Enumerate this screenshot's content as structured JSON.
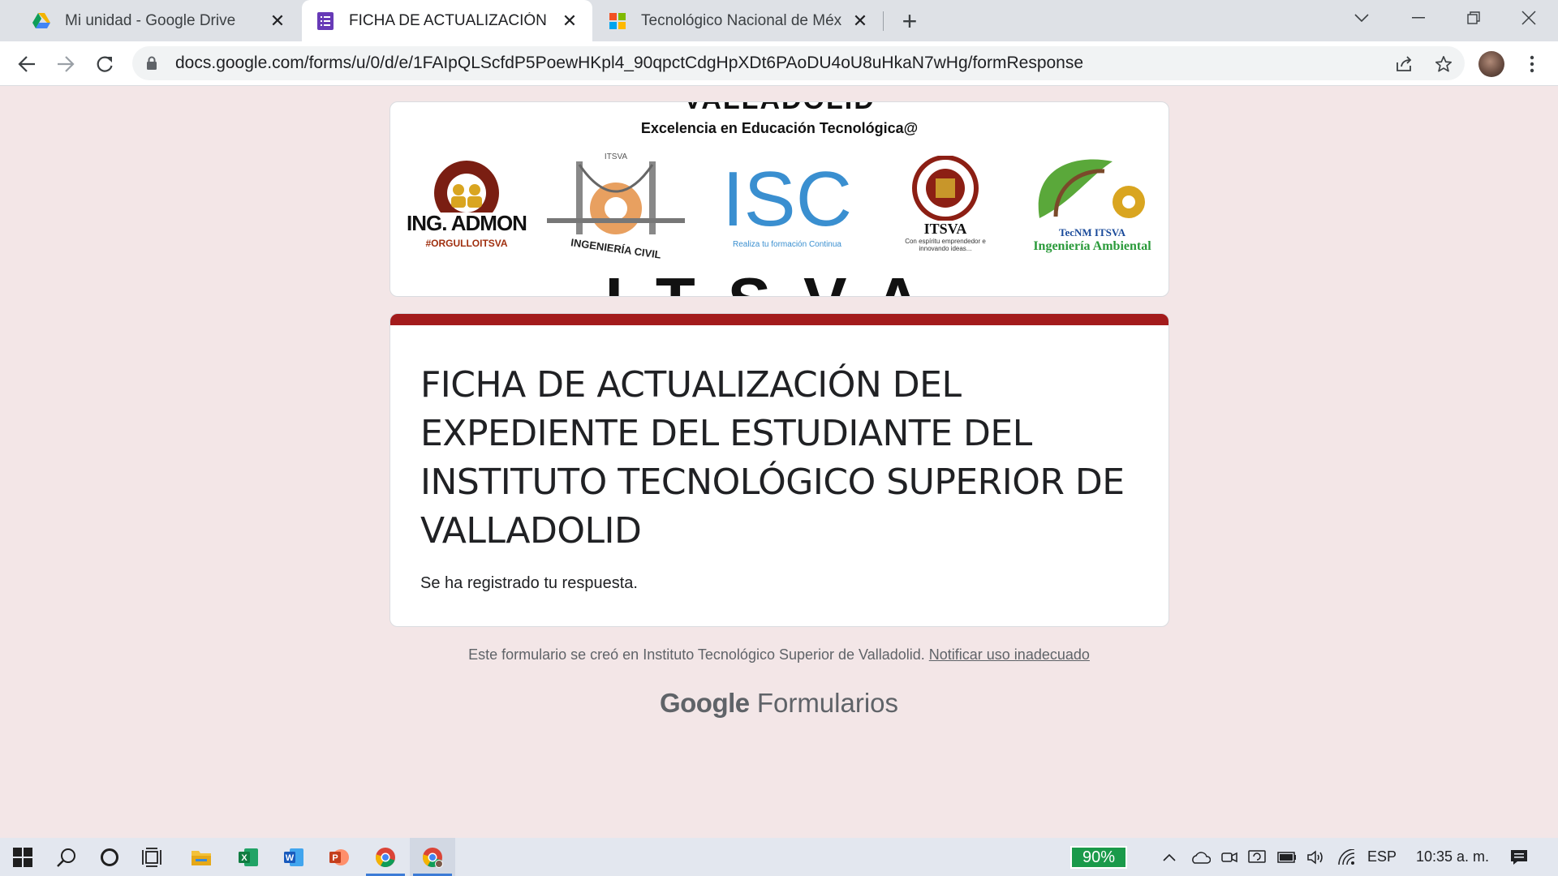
{
  "browser": {
    "tabs": [
      {
        "title": "Mi unidad - Google Drive",
        "icon": "google-drive-icon",
        "active": false
      },
      {
        "title": "FICHA DE ACTUALIZACIÓN DEL E",
        "icon": "google-forms-icon",
        "active": true
      },
      {
        "title": "Tecnológico Nacional de México",
        "icon": "microsoft-icon",
        "active": false
      }
    ],
    "close_glyph": "✕",
    "new_tab_glyph": "+",
    "url": "docs.google.com/forms/u/0/d/e/1FAIpQLScfdP5PoewHKpl4_90qpctCdgHpXDt6PAoDU4oU8uHkaN7wHg/formResponse"
  },
  "header_image": {
    "top_text": "VALLADOLID",
    "subtitle": "Excelencia en Educación Tecnológica@",
    "logos": [
      {
        "name": "ING. ADMON",
        "caption": "#ORGULLOITSVA"
      },
      {
        "name": "ITSVA",
        "caption": "INGENIERÍA CIVIL"
      },
      {
        "name": "ISC",
        "caption": "Realiza tu formación Continua"
      },
      {
        "name": "ITSVA",
        "caption": "Con espíritu emprendedor e innovando ideas..."
      },
      {
        "name": "TecNM ITSVA",
        "caption": "Ingeniería Ambiental"
      }
    ],
    "bottom_text": "ITSVA"
  },
  "form": {
    "title": "FICHA DE ACTUALIZACIÓN DEL EXPEDIENTE DEL ESTUDIANTE DEL INSTITUTO TECNOLÓGICO SUPERIOR DE VALLADOLID",
    "confirmation": "Se ha registrado tu respuesta.",
    "accent_color": "#a31b1c"
  },
  "footer": {
    "created_text": "Este formulario se creó en Instituto Tecnológico Superior de Valladolid.",
    "report_link": "Notificar uso inadecuado",
    "brand_google": "Google",
    "brand_product": "Formularios"
  },
  "taskbar": {
    "battery_percent": "90%",
    "language": "ESP",
    "time": "10:35 a. m."
  }
}
